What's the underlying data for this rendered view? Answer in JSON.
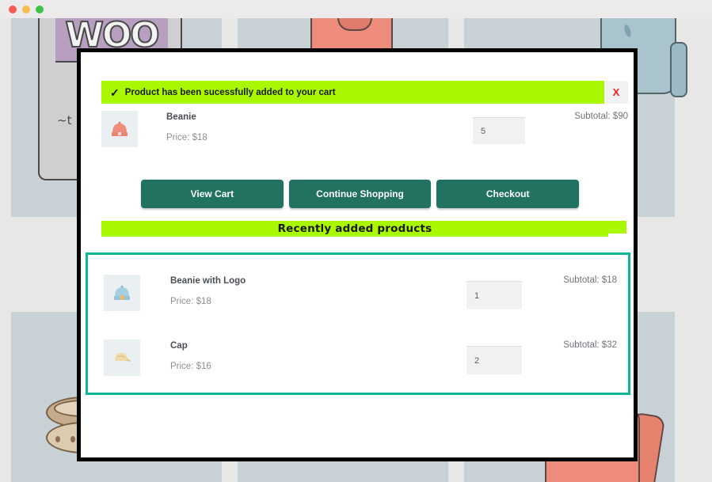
{
  "browser": {
    "dots": [
      "close-red",
      "minimize-yellow",
      "maximize-green"
    ]
  },
  "background": {
    "alt": "WooCommerce shop product grid with hoodie, beanie, bag, belt and shirt illustrations",
    "woo_logo_text": "WOO"
  },
  "modal": {
    "notice": {
      "icon": "check-icon",
      "message": "Product has been sucessfully added to your cart",
      "close_label": "X",
      "background_color": "#aaf800"
    },
    "cart_item": {
      "thumbnail": "beanie-salmon-icon",
      "name": "Beanie",
      "price_label": "Price: $18",
      "quantity": "5",
      "subtotal_label": "Subtotal: $90"
    },
    "actions": [
      {
        "label": "View Cart",
        "name": "view-cart-button"
      },
      {
        "label": "Continue Shopping",
        "name": "continue-shopping-button"
      },
      {
        "label": "Checkout",
        "name": "checkout-button"
      }
    ],
    "recent_section": {
      "heading": "Recently added products",
      "border_color": "#0fb894",
      "items": [
        {
          "thumbnail": "beanie-blue-logo-icon",
          "name": "Beanie with Logo",
          "price_label": "Price: $18",
          "quantity": "1",
          "subtotal_label": "Subtotal: $18"
        },
        {
          "thumbnail": "cap-tan-icon",
          "name": "Cap",
          "price_label": "Price: $16",
          "quantity": "2",
          "subtotal_label": "Subtotal: $32"
        }
      ]
    }
  },
  "colors": {
    "accent_green": "#aaf800",
    "button_teal": "#227261",
    "border_teal": "#0fb894",
    "close_red": "#e8231f"
  }
}
